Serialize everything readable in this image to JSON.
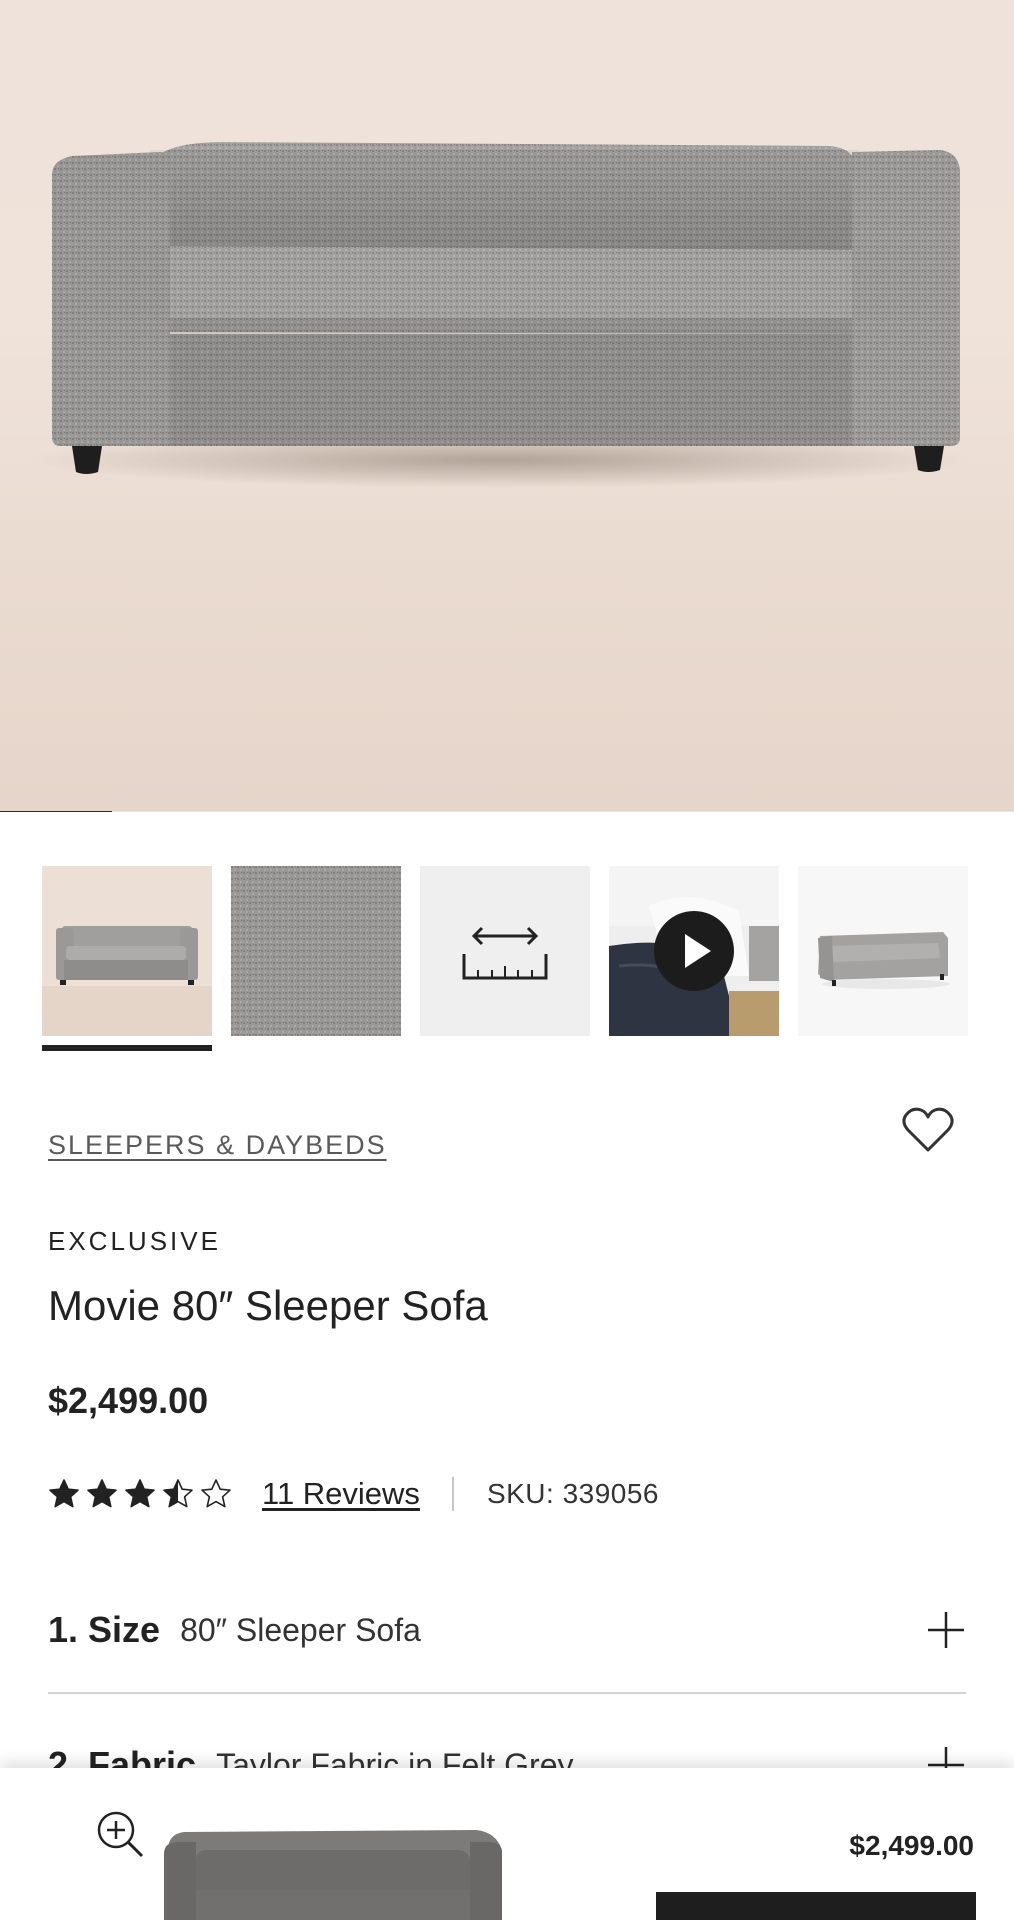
{
  "gallery": {
    "hero_alt": "Movie 80\" Sleeper Sofa in grey fabric",
    "progress": 0.11,
    "thumbnails": [
      {
        "name": "sofa-front",
        "selected": true
      },
      {
        "name": "fabric-swatch",
        "selected": false
      },
      {
        "name": "dimensions",
        "selected": false
      },
      {
        "name": "video",
        "selected": false
      },
      {
        "name": "sofa-angle",
        "selected": false
      }
    ]
  },
  "product": {
    "category": "SLEEPERS & DAYBEDS",
    "badge": "EXCLUSIVE",
    "title": "Movie 80″ Sleeper Sofa",
    "price": "$2,499.00",
    "rating": 3.5,
    "rating_max": 5,
    "reviews_label": "11 Reviews",
    "sku": "SKU: 339056"
  },
  "options": [
    {
      "step": "1. Size",
      "value": "80″ Sleeper Sofa"
    },
    {
      "step": "2. Fabric",
      "value": "Taylor Fabric in Felt Grey"
    }
  ],
  "sticky_bar": {
    "price": "$2,499.00"
  },
  "colors": {
    "text": "#222222",
    "button": "#1e1e1e",
    "fabric": "#9a9896"
  }
}
